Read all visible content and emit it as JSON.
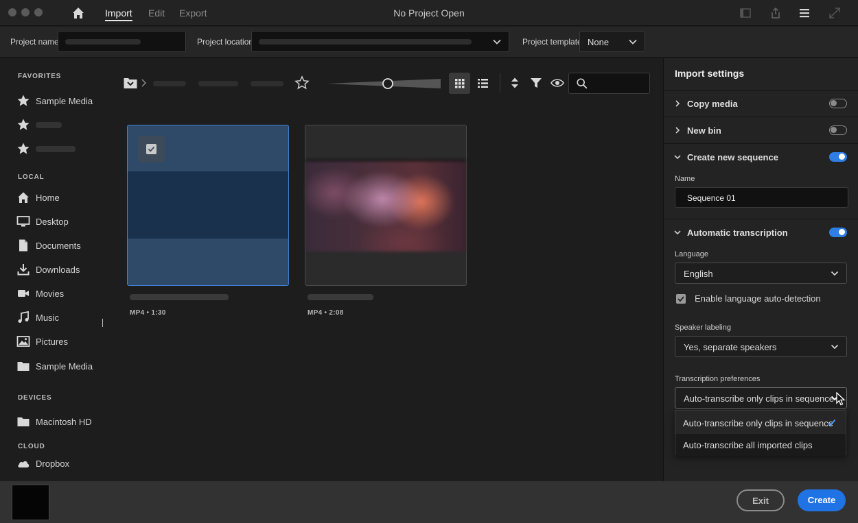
{
  "window": {
    "title": "No Project Open",
    "menu_tabs": [
      "Import",
      "Edit",
      "Export"
    ],
    "active_tab": "Import"
  },
  "project_bar": {
    "name_label": "Project name",
    "location_label": "Project location",
    "template_label": "Project template",
    "template_value": "None"
  },
  "sidebar": {
    "favorites_head": "FAVORITES",
    "favorites": [
      "Sample Media"
    ],
    "local_head": "LOCAL",
    "local": [
      "Home",
      "Desktop",
      "Documents",
      "Downloads",
      "Movies",
      "Music",
      "Pictures",
      "Sample Media"
    ],
    "devices_head": "DEVICES",
    "devices": [
      "Macintosh HD"
    ],
    "cloud_head": "CLOUD",
    "cloud": [
      "Dropbox"
    ]
  },
  "browser": {
    "clips": [
      {
        "meta": "MP4 • 1:30",
        "selected": true
      },
      {
        "meta": "MP4 • 2:08",
        "selected": false
      }
    ]
  },
  "import_settings": {
    "title": "Import settings",
    "copy_media": {
      "label": "Copy media",
      "enabled": false
    },
    "new_bin": {
      "label": "New bin",
      "enabled": false
    },
    "create_sequence": {
      "label": "Create new sequence",
      "enabled": true,
      "name_label": "Name",
      "name_value": "Sequence 01"
    },
    "transcription": {
      "label": "Automatic transcription",
      "enabled": true,
      "language_label": "Language",
      "language_value": "English",
      "auto_detect_label": "Enable language auto-detection",
      "auto_detect_checked": true,
      "speaker_label": "Speaker labeling",
      "speaker_value": "Yes, separate speakers",
      "prefs_label": "Transcription preferences",
      "prefs_value": "Auto-transcribe only clips in sequence",
      "prefs_options": [
        "Auto-transcribe only clips in sequence",
        "Auto-transcribe all imported clips"
      ]
    }
  },
  "footer": {
    "exit_label": "Exit",
    "create_label": "Create"
  },
  "colors": {
    "accent": "#1f73e5",
    "selection_border": "#3f7fd4",
    "background": "#1d1d1d"
  }
}
